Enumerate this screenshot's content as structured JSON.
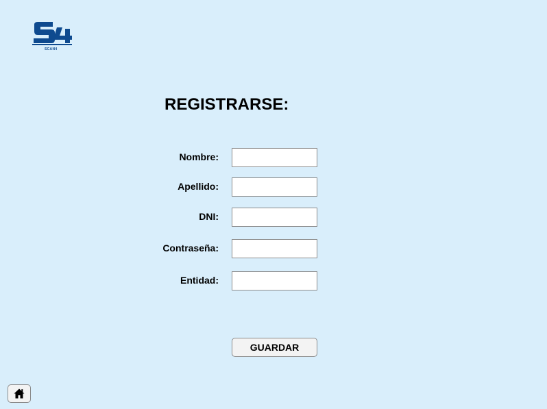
{
  "logo": {
    "text": "SCAN4",
    "color": "#0e4a8f"
  },
  "page": {
    "title": "REGISTRARSE:",
    "background": "#d9eefb"
  },
  "form": {
    "fields": [
      {
        "label": "Nombre:",
        "value": ""
      },
      {
        "label": "Apellido:",
        "value": ""
      },
      {
        "label": "DNI:",
        "value": ""
      },
      {
        "label": "Contraseña:",
        "value": ""
      },
      {
        "label": "Entidad:",
        "value": ""
      }
    ],
    "save_label": "GUARDAR"
  },
  "footer": {
    "home_icon": "home-icon"
  }
}
